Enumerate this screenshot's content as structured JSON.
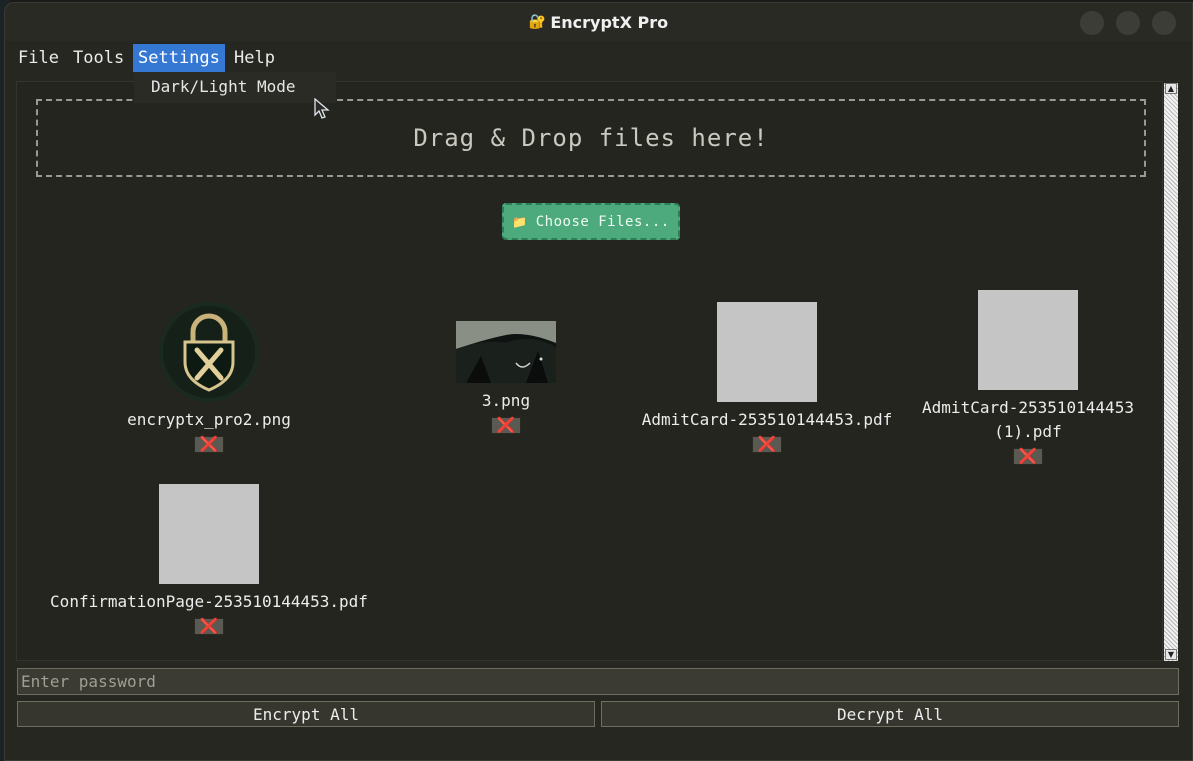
{
  "window": {
    "title": "EncryptX Pro",
    "title_icon": "🔐"
  },
  "menubar": {
    "items": [
      "File",
      "Tools",
      "Settings",
      "Help"
    ],
    "active": "Settings"
  },
  "dropdown": {
    "items": [
      "Dark/Light Mode"
    ]
  },
  "dropzone": {
    "text": "Drag & Drop files here!"
  },
  "choose_button": {
    "icon": "📁",
    "label": "Choose Files..."
  },
  "files": [
    {
      "name": "encryptx_pro2.png",
      "thumb": "lock-logo"
    },
    {
      "name": "3.png",
      "thumb": "dark-landscape"
    },
    {
      "name": "AdmitCard-253510144453.pdf",
      "thumb": "grey-placeholder"
    },
    {
      "name": "AdmitCard-253510144453\n(1).pdf",
      "thumb": "grey-placeholder"
    },
    {
      "name": "ConfirmationPage-253510144453.pdf",
      "thumb": "grey-placeholder"
    }
  ],
  "delete_icon": "❌",
  "password": {
    "placeholder": "Enter password",
    "value": ""
  },
  "actions": {
    "encrypt_label": "Encrypt All",
    "decrypt_label": "Decrypt All"
  },
  "colors": {
    "accent": "#3478d4",
    "choose_button": "#4daa7c",
    "delete": "#e0341e"
  }
}
